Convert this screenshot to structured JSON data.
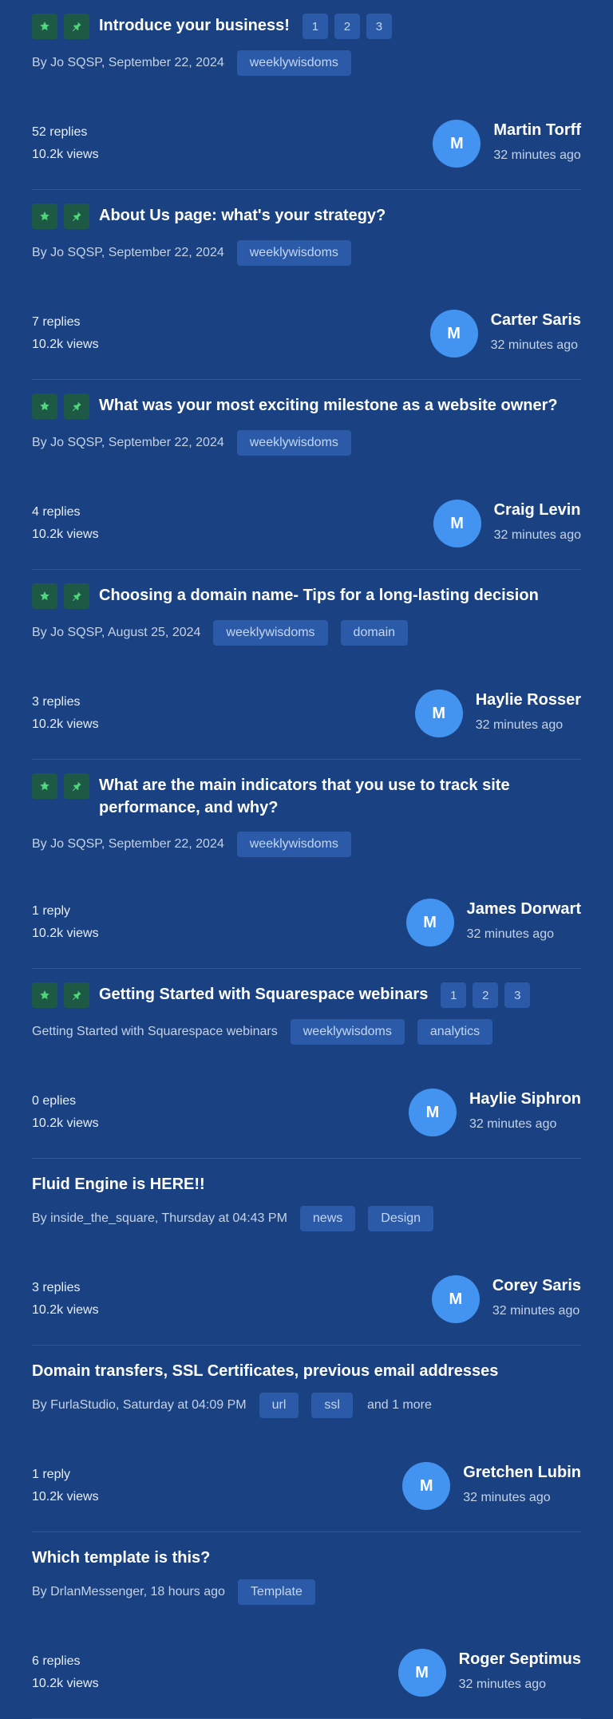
{
  "topics": [
    {
      "title": "Introduce your business!",
      "pinned": true,
      "pages": [
        "1",
        "2",
        "3"
      ],
      "byline": "By Jo SQSP, September 22, 2024",
      "tags": [
        "weeklywisdoms"
      ],
      "more": "",
      "replies": "52 replies",
      "views": "10.2k views",
      "avatar_letter": "M",
      "user": "Martin Torff",
      "time": "32 minutes ago"
    },
    {
      "title": "About Us page: what's your strategy?",
      "pinned": true,
      "pages": [],
      "byline": "By Jo SQSP, September 22, 2024",
      "tags": [
        "weeklywisdoms"
      ],
      "more": "",
      "replies": "7 replies",
      "views": "10.2k views",
      "avatar_letter": "M",
      "user": "Carter Saris",
      "time": "32 minutes ago"
    },
    {
      "title": "What was your most exciting milestone as a website owner?",
      "pinned": true,
      "pages": [],
      "byline": "By Jo SQSP, September 22, 2024",
      "tags": [
        "weeklywisdoms"
      ],
      "more": "",
      "replies": "4 replies",
      "views": "10.2k views",
      "avatar_letter": "M",
      "user": "Craig Levin",
      "time": "32 minutes ago"
    },
    {
      "title": "Choosing a domain name- Tips for a long-lasting decision",
      "pinned": true,
      "pages": [],
      "byline": "By Jo SQSP, August 25, 2024",
      "tags": [
        "weeklywisdoms",
        "domain"
      ],
      "more": "",
      "replies": "3 replies",
      "views": "10.2k views",
      "avatar_letter": "M",
      "user": "Haylie Rosser",
      "time": "32 minutes ago"
    },
    {
      "title": "What are the main indicators that you use to track site performance, and why?",
      "pinned": true,
      "pages": [],
      "byline": "By Jo SQSP, September 22, 2024",
      "tags": [
        "weeklywisdoms"
      ],
      "more": "",
      "replies": "1 reply",
      "views": "10.2k views",
      "avatar_letter": "M",
      "user": "James Dorwart",
      "time": "32 minutes ago"
    },
    {
      "title": "Getting Started with Squarespace webinars",
      "pinned": true,
      "pages": [
        "1",
        "2",
        "3"
      ],
      "byline": "Getting Started with Squarespace webinars",
      "tags": [
        "weeklywisdoms",
        "analytics"
      ],
      "more": "",
      "replies": "0 eplies",
      "views": "10.2k views",
      "avatar_letter": "M",
      "user": "Haylie Siphron",
      "time": "32 minutes ago"
    },
    {
      "title": "Fluid Engine is HERE!!",
      "pinned": false,
      "pages": [],
      "byline": "By inside_the_square, Thursday at 04:43 PM",
      "tags": [
        "news",
        "Design"
      ],
      "more": "",
      "replies": "3 replies",
      "views": "10.2k views",
      "avatar_letter": "M",
      "user": "Corey Saris",
      "time": "32 minutes ago"
    },
    {
      "title": "Domain transfers, SSL Certificates, previous email addresses",
      "pinned": false,
      "pages": [],
      "byline": "By FurlaStudio, Saturday at 04:09 PM",
      "tags": [
        "url",
        "ssl"
      ],
      "more": "and 1 more",
      "replies": "1 reply",
      "views": "10.2k views",
      "avatar_letter": "M",
      "user": "Gretchen Lubin",
      "time": "32 minutes ago"
    },
    {
      "title": "Which template is this?",
      "pinned": false,
      "pages": [],
      "byline": "By DrlanMessenger, 18 hours ago",
      "tags": [
        "Template"
      ],
      "more": "",
      "replies": "6 replies",
      "views": "10.2k views",
      "avatar_letter": "M",
      "user": "Roger Septimus",
      "time": "32 minutes ago"
    }
  ],
  "icons": {
    "featured": "star-icon",
    "pinned": "pin-icon"
  },
  "colors": {
    "background": "#1a4282",
    "icon_bg": "#1e5946",
    "icon_fg": "#4fd67a",
    "tag_bg": "#2b5aa8",
    "tag_fg": "#c4d7f2",
    "avatar_bg": "#4394f0"
  }
}
